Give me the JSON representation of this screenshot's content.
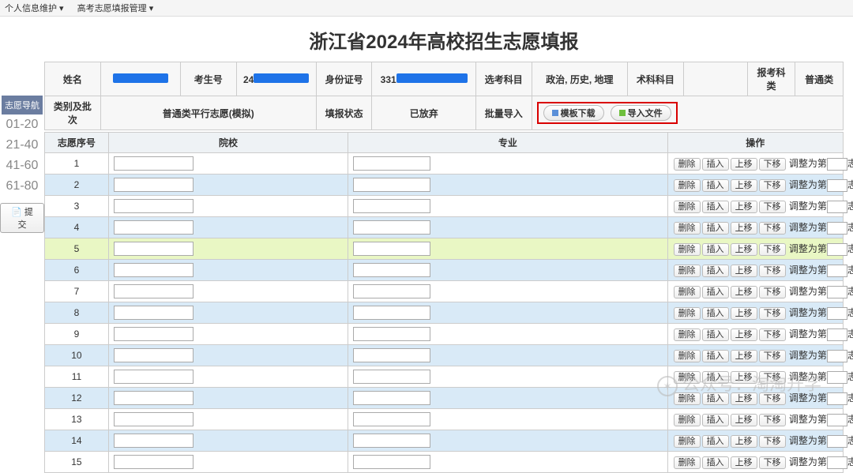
{
  "topMenu": {
    "item1": "个人信息维护 ▾",
    "item2": "高考志愿填报管理 ▾"
  },
  "title": "浙江省2024年高校招生志愿填报",
  "info": {
    "name_lbl": "姓名",
    "examno_lbl": "考生号",
    "examno_val": "24",
    "idno_lbl": "身份证号",
    "idno_val": "331",
    "subj_lbl": "选考科目",
    "subj_val": "政治, 历史, 地理",
    "tech_lbl": "术科科目",
    "tech_val": "",
    "cat_lbl": "报考科类",
    "cat_val": "普通类",
    "type_lbl": "类别及批次",
    "type_val": "普通类平行志愿(模拟)",
    "status_lbl": "填报状态",
    "status_val": "已放弃",
    "import_lbl": "批量导入",
    "tpl_btn": "模板下载",
    "imp_btn": "导入文件"
  },
  "nav": {
    "title": "志愿导航",
    "r1": "01-20",
    "r2": "21-40",
    "r3": "41-60",
    "r4": "61-80",
    "submit": "提交"
  },
  "cols": {
    "seq": "志愿序号",
    "school": "院校",
    "major": "专业",
    "op": "操作"
  },
  "ops": {
    "del": "删除",
    "ins": "插入",
    "up": "上移",
    "down": "下移",
    "adj1": "调整为第",
    "adj2": "志愿"
  },
  "rows": [
    1,
    2,
    3,
    4,
    5,
    6,
    7,
    8,
    9,
    10,
    11,
    12,
    13,
    14,
    15
  ],
  "highlight": 5,
  "watermark": "公众号：淘淘升学"
}
